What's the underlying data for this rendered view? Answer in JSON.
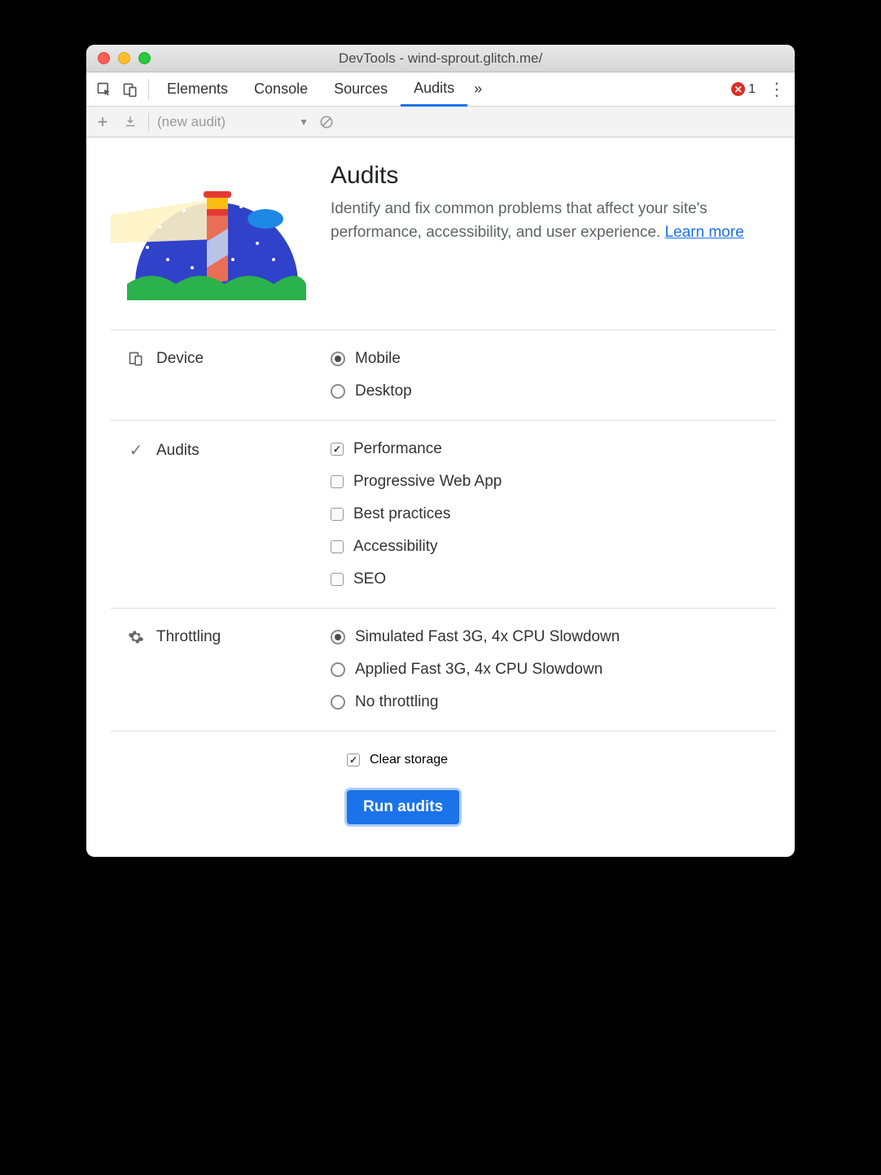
{
  "window": {
    "title": "DevTools - wind-sprout.glitch.me/"
  },
  "tabs": {
    "items": [
      "Elements",
      "Console",
      "Sources",
      "Audits"
    ],
    "active": "Audits",
    "overflow": "»",
    "errors": "1"
  },
  "subbar": {
    "dropdown": "(new audit)"
  },
  "hero": {
    "title": "Audits",
    "desc": "Identify and fix common problems that affect your site's performance, accessibility, and user experience. ",
    "link": "Learn more"
  },
  "sections": {
    "device": {
      "label": "Device",
      "options": [
        {
          "label": "Mobile",
          "checked": true
        },
        {
          "label": "Desktop",
          "checked": false
        }
      ]
    },
    "audits": {
      "label": "Audits",
      "options": [
        {
          "label": "Performance",
          "checked": true
        },
        {
          "label": "Progressive Web App",
          "checked": false
        },
        {
          "label": "Best practices",
          "checked": false
        },
        {
          "label": "Accessibility",
          "checked": false
        },
        {
          "label": "SEO",
          "checked": false
        }
      ]
    },
    "throttling": {
      "label": "Throttling",
      "options": [
        {
          "label": "Simulated Fast 3G, 4x CPU Slowdown",
          "checked": true
        },
        {
          "label": "Applied Fast 3G, 4x CPU Slowdown",
          "checked": false
        },
        {
          "label": "No throttling",
          "checked": false
        }
      ]
    }
  },
  "actions": {
    "clear_storage": {
      "label": "Clear storage",
      "checked": true
    },
    "run": "Run audits"
  }
}
